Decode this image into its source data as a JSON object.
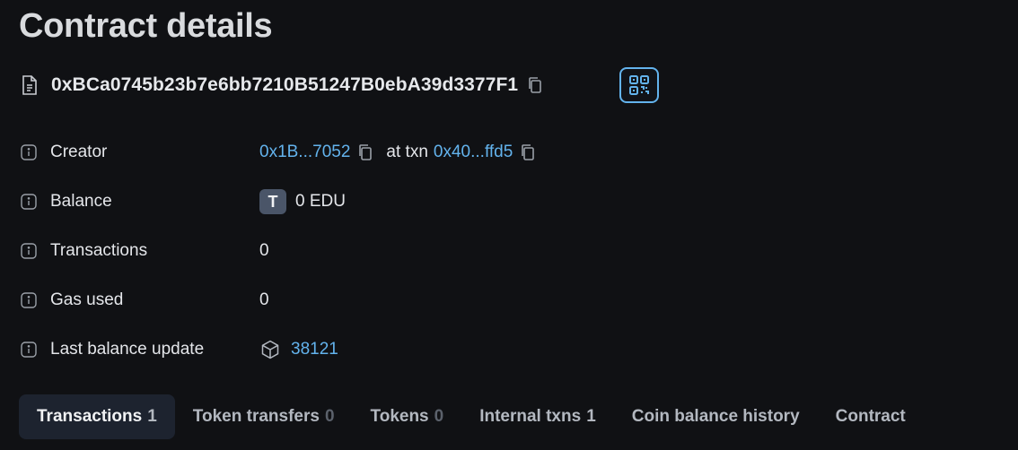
{
  "page": {
    "title": "Contract details"
  },
  "address": {
    "value": "0xBCa0745b23b7e6bb7210B51247B0ebA39d3377F1"
  },
  "details": {
    "creator": {
      "label": "Creator",
      "address": "0x1B...7052",
      "at_txn_text": "at txn",
      "txn": "0x40...ffd5"
    },
    "balance": {
      "label": "Balance",
      "token_letter": "T",
      "value": "0 EDU"
    },
    "transactions": {
      "label": "Transactions",
      "value": "0"
    },
    "gas_used": {
      "label": "Gas used",
      "value": "0"
    },
    "last_balance_update": {
      "label": "Last balance update",
      "value": "38121"
    }
  },
  "tabs": [
    {
      "label": "Transactions",
      "count": "1"
    },
    {
      "label": "Token transfers",
      "count": "0"
    },
    {
      "label": "Tokens",
      "count": "0"
    },
    {
      "label": "Internal txns",
      "count": "1"
    },
    {
      "label": "Coin balance history",
      "count": ""
    },
    {
      "label": "Contract",
      "count": ""
    }
  ],
  "colors": {
    "background": "#101114",
    "link": "#63b3ed",
    "active_tab_bg": "#1d232f",
    "badge": "#4a5568"
  },
  "icons": {
    "address": "document-icon",
    "copy": "copy-icon",
    "qr": "qr-code-icon",
    "info": "info-icon",
    "block": "block-icon"
  }
}
